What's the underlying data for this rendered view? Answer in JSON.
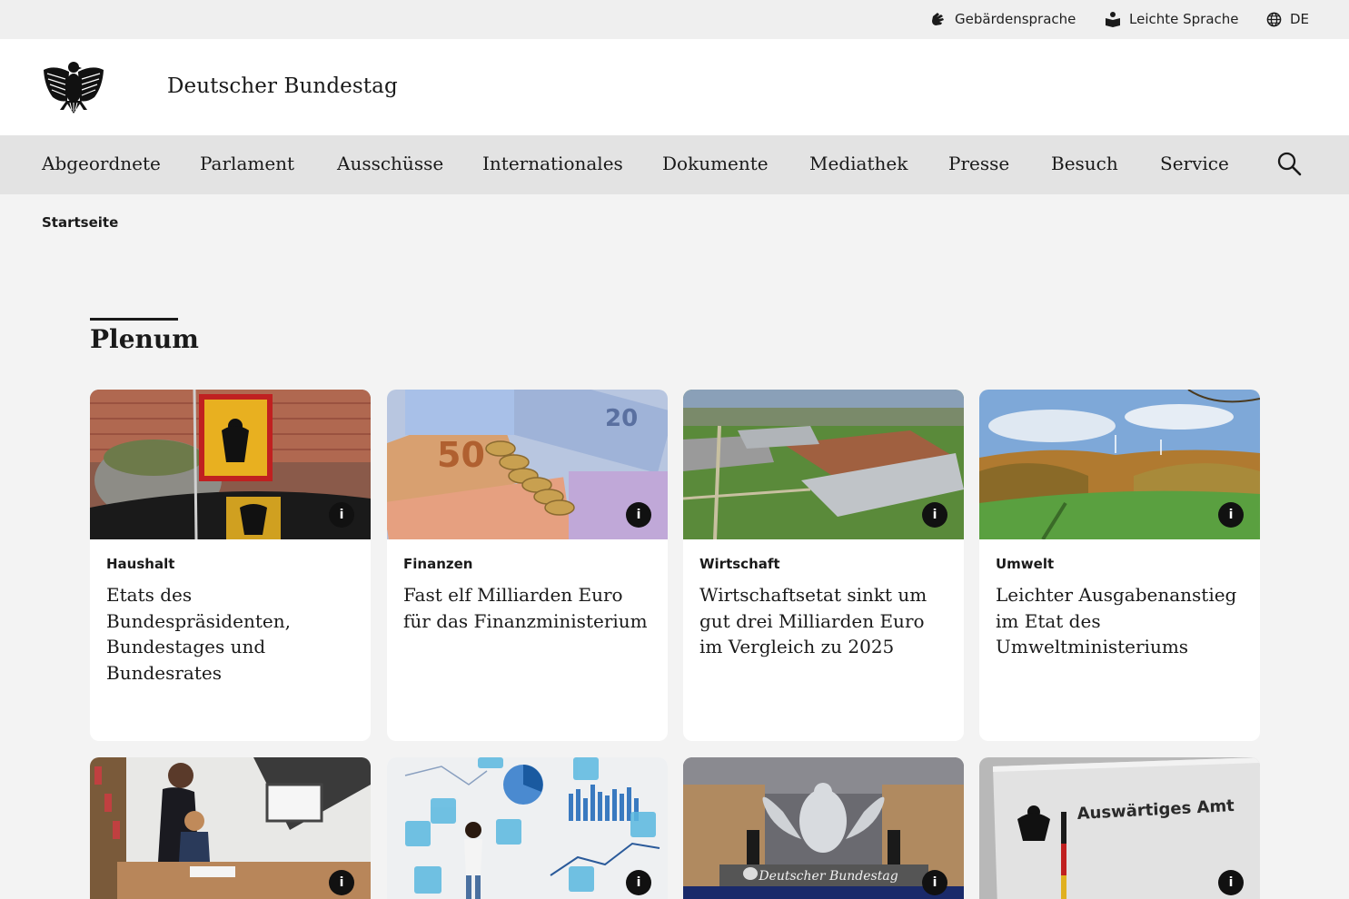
{
  "utility_bar": {
    "items": [
      {
        "label": "Gebärdensprache",
        "icon": "sign-language-hand-icon"
      },
      {
        "label": "Leichte Sprache",
        "icon": "easy-language-book-icon"
      },
      {
        "label": "DE",
        "icon": "globe-icon"
      }
    ]
  },
  "header": {
    "site_title": "Deutscher Bundestag",
    "logo": "bundesadler-eagle-logo"
  },
  "nav": {
    "items": [
      {
        "label": "Abgeordnete"
      },
      {
        "label": "Parlament"
      },
      {
        "label": "Ausschüsse"
      },
      {
        "label": "Internationales"
      },
      {
        "label": "Dokumente"
      },
      {
        "label": "Mediathek"
      },
      {
        "label": "Presse"
      },
      {
        "label": "Besuch"
      },
      {
        "label": "Service"
      }
    ],
    "search_icon": "search-icon"
  },
  "breadcrumb": {
    "current": "Startseite"
  },
  "section": {
    "title": "Plenum"
  },
  "cards": [
    {
      "category": "Haushalt",
      "title": "Etats des Bundespräsidenten, Bundestages und Bundesrates",
      "info": "i",
      "image": "flag-with-federal-eagle-photo"
    },
    {
      "category": "Finanzen",
      "title": "Fast elf Milliarden Euro für das Finanzministerium",
      "info": "i",
      "image": "euro-banknotes-and-coins-photo"
    },
    {
      "category": "Wirtschaft",
      "title": "Wirtschaftsetat sinkt um gut drei Milliarden Euro im Vergleich zu 2025",
      "info": "i",
      "image": "industrial-park-aerial-photo"
    },
    {
      "category": "Umwelt",
      "title": "Leichter Ausgabenanstieg im Etat des Umweltministeriums",
      "info": "i",
      "image": "autumn-landscape-wind-turbines-photo"
    },
    {
      "category": "",
      "title": "",
      "info": "i",
      "image": "mother-and-daughter-homework-photo"
    },
    {
      "category": "",
      "title": "",
      "info": "i",
      "image": "person-with-data-graphics-photo"
    },
    {
      "category": "",
      "title": "",
      "info": "i",
      "image": "plenary-hall-eagle-photo",
      "image_text": "Deutscher Bundestag"
    },
    {
      "category": "",
      "title": "",
      "info": "i",
      "image": "auswaertiges-amt-sign-photo",
      "image_text": "Auswärtiges Amt"
    }
  ]
}
